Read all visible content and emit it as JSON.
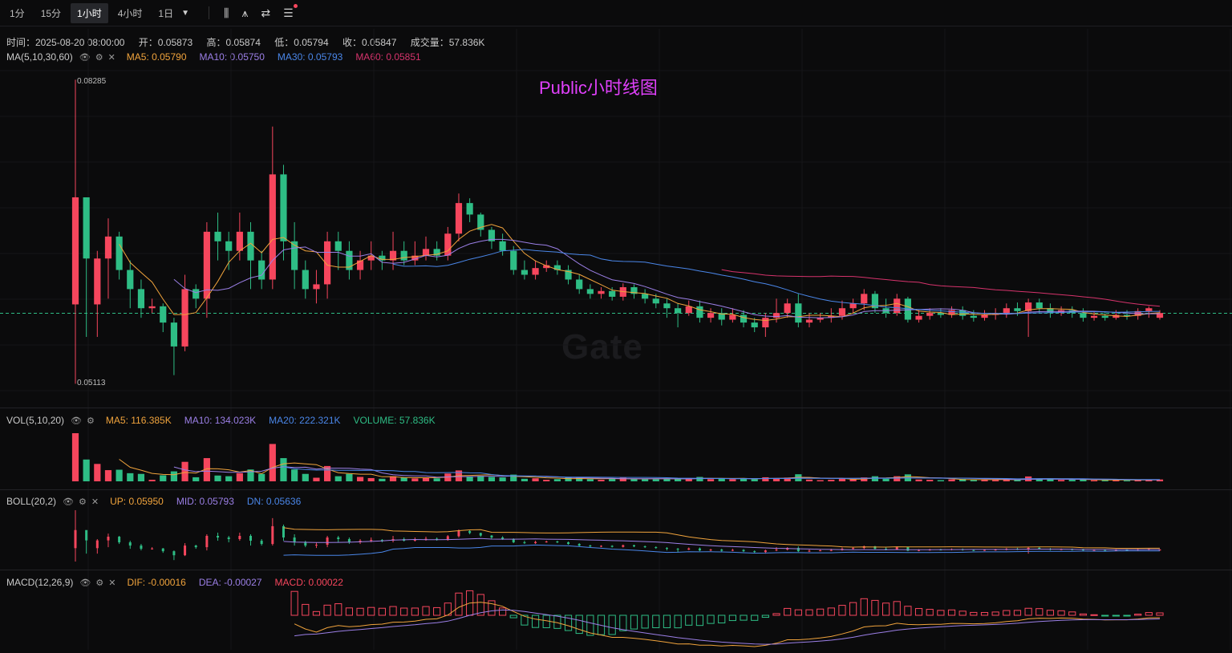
{
  "toolbar": {
    "timeframes": [
      "1分",
      "15分",
      "1小时",
      "4小时",
      "1日"
    ],
    "active": "1小时"
  },
  "info": {
    "time": "时间：2025-08-20 08:00:00",
    "open": "开：0.05873",
    "high": "高：0.05874",
    "low": "低：0.05794",
    "close": "收：0.05847",
    "volume": "成交量：57.836K"
  },
  "ma": {
    "name": "MA(5,10,30,60)",
    "ma5": "MA5: 0.05790",
    "ma10": "MA10: 0.05750",
    "ma30": "MA30: 0.05793",
    "ma60": "MA60: 0.05851"
  },
  "vol": {
    "name": "VOL(5,10,20)",
    "ma5": "MA5: 116.385K",
    "ma10": "MA10: 134.023K",
    "ma20": "MA20: 222.321K",
    "volume": "VOLUME: 57.836K"
  },
  "boll": {
    "name": "BOLL(20,2)",
    "up": "UP: 0.05950",
    "mid": "MID: 0.05793",
    "dn": "DN: 0.05636"
  },
  "macd": {
    "name": "MACD(12,26,9)",
    "dif": "DIF: -0.00016",
    "dea": "DEA: -0.00027",
    "macd": "MACD: 0.00022"
  },
  "title": "Public小时线图",
  "watermark": "Gate",
  "colors": {
    "up": "#f6465d",
    "down": "#2ebd85",
    "ma5": "#f0a33c",
    "ma10": "#9b7fe6",
    "ma30": "#4a86e8",
    "ma60": "#d6336c"
  },
  "chart_data": {
    "type": "candlestick",
    "title": "Public小时线图",
    "price_range": [
      0.05113,
      0.08285
    ],
    "high_label": "0.08285",
    "low_label": "0.05113",
    "last_close": 0.05847,
    "candles": [
      [
        0.0594,
        0.0706,
        0.0829,
        0.0511
      ],
      [
        0.0706,
        0.0642,
        0.066,
        0.056
      ],
      [
        0.0594,
        0.0642,
        0.065,
        0.056
      ],
      [
        0.0642,
        0.0665,
        0.0684,
        0.06
      ],
      [
        0.0665,
        0.063,
        0.067,
        0.062
      ],
      [
        0.063,
        0.061,
        0.064,
        0.059
      ],
      [
        0.061,
        0.059,
        0.062,
        0.058
      ],
      [
        0.059,
        0.0592,
        0.06,
        0.0585
      ],
      [
        0.0592,
        0.0575,
        0.0595,
        0.0565
      ],
      [
        0.0575,
        0.055,
        0.058,
        0.052
      ],
      [
        0.055,
        0.061,
        0.0625,
        0.0545
      ],
      [
        0.061,
        0.06,
        0.0615,
        0.059
      ],
      [
        0.06,
        0.067,
        0.068,
        0.058
      ],
      [
        0.067,
        0.066,
        0.069,
        0.064
      ],
      [
        0.066,
        0.065,
        0.067,
        0.063
      ],
      [
        0.065,
        0.067,
        0.069,
        0.064
      ],
      [
        0.067,
        0.064,
        0.068,
        0.061
      ],
      [
        0.064,
        0.062,
        0.065,
        0.061
      ],
      [
        0.062,
        0.073,
        0.078,
        0.061
      ],
      [
        0.073,
        0.066,
        0.074,
        0.064
      ],
      [
        0.066,
        0.063,
        0.068,
        0.061
      ],
      [
        0.063,
        0.061,
        0.064,
        0.06
      ],
      [
        0.061,
        0.0615,
        0.063,
        0.0595
      ],
      [
        0.0615,
        0.066,
        0.067,
        0.06
      ],
      [
        0.066,
        0.065,
        0.067,
        0.063
      ],
      [
        0.065,
        0.063,
        0.066,
        0.062
      ],
      [
        0.063,
        0.064,
        0.065,
        0.062
      ],
      [
        0.064,
        0.0645,
        0.066,
        0.063
      ],
      [
        0.0645,
        0.064,
        0.065,
        0.063
      ],
      [
        0.064,
        0.065,
        0.067,
        0.063
      ],
      [
        0.065,
        0.064,
        0.066,
        0.0635
      ],
      [
        0.064,
        0.0645,
        0.066,
        0.0635
      ],
      [
        0.0645,
        0.0652,
        0.0665,
        0.064
      ],
      [
        0.0652,
        0.0645,
        0.066,
        0.064
      ],
      [
        0.0645,
        0.0668,
        0.0675,
        0.064
      ],
      [
        0.0668,
        0.07,
        0.071,
        0.066
      ],
      [
        0.07,
        0.0688,
        0.0705,
        0.068
      ],
      [
        0.0688,
        0.0672,
        0.069,
        0.0665
      ],
      [
        0.0672,
        0.066,
        0.0675,
        0.0652
      ],
      [
        0.066,
        0.065,
        0.0668,
        0.0645
      ],
      [
        0.065,
        0.063,
        0.0655,
        0.0625
      ],
      [
        0.063,
        0.0625,
        0.064,
        0.062
      ],
      [
        0.0625,
        0.0632,
        0.064,
        0.062
      ],
      [
        0.0632,
        0.0635,
        0.064,
        0.0628
      ],
      [
        0.0635,
        0.063,
        0.064,
        0.0625
      ],
      [
        0.063,
        0.062,
        0.0635,
        0.0615
      ],
      [
        0.062,
        0.061,
        0.0625,
        0.0605
      ],
      [
        0.061,
        0.0605,
        0.0615,
        0.06
      ],
      [
        0.0605,
        0.0608,
        0.0612,
        0.06
      ],
      [
        0.0608,
        0.0602,
        0.0612,
        0.0598
      ],
      [
        0.0602,
        0.0612,
        0.0616,
        0.0598
      ],
      [
        0.0612,
        0.0605,
        0.0615,
        0.06
      ],
      [
        0.0605,
        0.06,
        0.061,
        0.0595
      ],
      [
        0.06,
        0.0595,
        0.0605,
        0.059
      ],
      [
        0.0595,
        0.059,
        0.06,
        0.058
      ],
      [
        0.059,
        0.0585,
        0.0595,
        0.057
      ],
      [
        0.0585,
        0.0592,
        0.0598,
        0.0582
      ],
      [
        0.0592,
        0.058,
        0.0598,
        0.0575
      ],
      [
        0.058,
        0.0585,
        0.059,
        0.0575
      ],
      [
        0.0585,
        0.0578,
        0.059,
        0.0572
      ],
      [
        0.0578,
        0.0583,
        0.059,
        0.0575
      ],
      [
        0.0583,
        0.0575,
        0.0588,
        0.057
      ],
      [
        0.0575,
        0.057,
        0.058,
        0.0565
      ],
      [
        0.057,
        0.058,
        0.0585,
        0.056
      ],
      [
        0.058,
        0.0585,
        0.06,
        0.0575
      ],
      [
        0.0585,
        0.0595,
        0.06,
        0.058
      ],
      [
        0.0595,
        0.0575,
        0.0605,
        0.057
      ],
      [
        0.0575,
        0.0578,
        0.0585,
        0.057
      ],
      [
        0.0578,
        0.058,
        0.0585,
        0.0575
      ],
      [
        0.058,
        0.0582,
        0.059,
        0.0575
      ],
      [
        0.0582,
        0.059,
        0.0598,
        0.0578
      ],
      [
        0.059,
        0.0595,
        0.06,
        0.0585
      ],
      [
        0.0595,
        0.0605,
        0.061,
        0.0588
      ],
      [
        0.0605,
        0.059,
        0.0608,
        0.0585
      ],
      [
        0.059,
        0.0585,
        0.06,
        0.058
      ],
      [
        0.0585,
        0.06,
        0.0605,
        0.0582
      ],
      [
        0.06,
        0.0578,
        0.0602,
        0.0575
      ],
      [
        0.0578,
        0.0582,
        0.0588,
        0.0575
      ],
      [
        0.0582,
        0.0585,
        0.059,
        0.0578
      ],
      [
        0.0585,
        0.0583,
        0.059,
        0.058
      ],
      [
        0.0583,
        0.0588,
        0.0592,
        0.058
      ],
      [
        0.0588,
        0.0582,
        0.0592,
        0.0578
      ],
      [
        0.0582,
        0.058,
        0.0588,
        0.0576
      ],
      [
        0.058,
        0.0583,
        0.0588,
        0.0577
      ],
      [
        0.0583,
        0.0585,
        0.059,
        0.0578
      ],
      [
        0.0585,
        0.059,
        0.0595,
        0.058
      ],
      [
        0.059,
        0.0587,
        0.0596,
        0.0582
      ],
      [
        0.0587,
        0.0596,
        0.06,
        0.056
      ],
      [
        0.0596,
        0.059,
        0.06,
        0.0585
      ],
      [
        0.059,
        0.0585,
        0.0595,
        0.058
      ],
      [
        0.0585,
        0.0588,
        0.0592,
        0.0582
      ],
      [
        0.0588,
        0.0585,
        0.0592,
        0.058
      ],
      [
        0.0585,
        0.058,
        0.059,
        0.0576
      ],
      [
        0.058,
        0.0582,
        0.0586,
        0.0577
      ],
      [
        0.0582,
        0.058,
        0.0586,
        0.0577
      ],
      [
        0.058,
        0.0583,
        0.0588,
        0.0578
      ],
      [
        0.0583,
        0.0582,
        0.0588,
        0.0578
      ],
      [
        0.0582,
        0.0587,
        0.059,
        0.0578
      ],
      [
        0.0587,
        0.059,
        0.0592,
        0.058
      ],
      [
        0.058,
        0.0585,
        0.0588,
        0.0578
      ]
    ]
  }
}
